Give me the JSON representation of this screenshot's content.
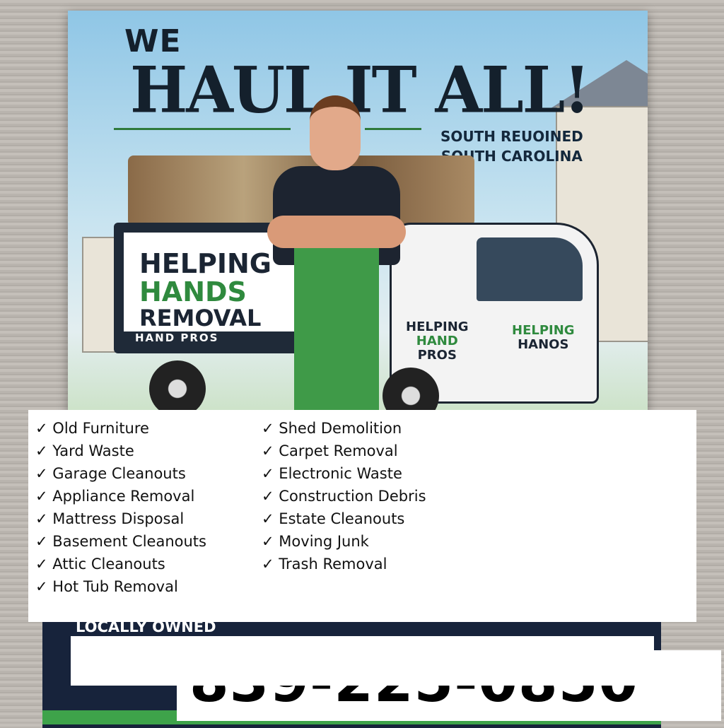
{
  "poster": {
    "headline_top": "WE",
    "headline_main": "HAUL IT ALL!",
    "subtitle_line1": "SOUTH REUOINED",
    "subtitle_line2": "SOUTH CAROLINA",
    "truck_box": {
      "line1": "HELPING",
      "line2": "HANDS",
      "line3": "REMOVAL",
      "line4": "HAND PROS"
    },
    "truck_door": {
      "line1": "HELPING",
      "line2": "HAND",
      "line3": "PROS"
    },
    "truck_hood": {
      "line1": "HELPING",
      "line2": "HANOS"
    },
    "locally_owned": "LOCALLY OWNED",
    "colors": {
      "navy": "#17233b",
      "green": "#3ea34a",
      "sky": "#8fc6e6"
    }
  },
  "services": {
    "check_icon": "✓",
    "left": [
      "Old Furniture",
      "Yard Waste",
      "Garage Cleanouts",
      "Appliance Removal",
      "Mattress Disposal",
      "Basement Cleanouts",
      "Attic Cleanouts",
      "Hot Tub Removal"
    ],
    "right": [
      "Shed Demolition",
      "Carpet Removal",
      "Electronic Waste",
      "Construction Debris",
      "Estate Cleanouts",
      "Moving Junk",
      "Trash Removal"
    ]
  },
  "contact": {
    "phone": "839-225-0850"
  }
}
